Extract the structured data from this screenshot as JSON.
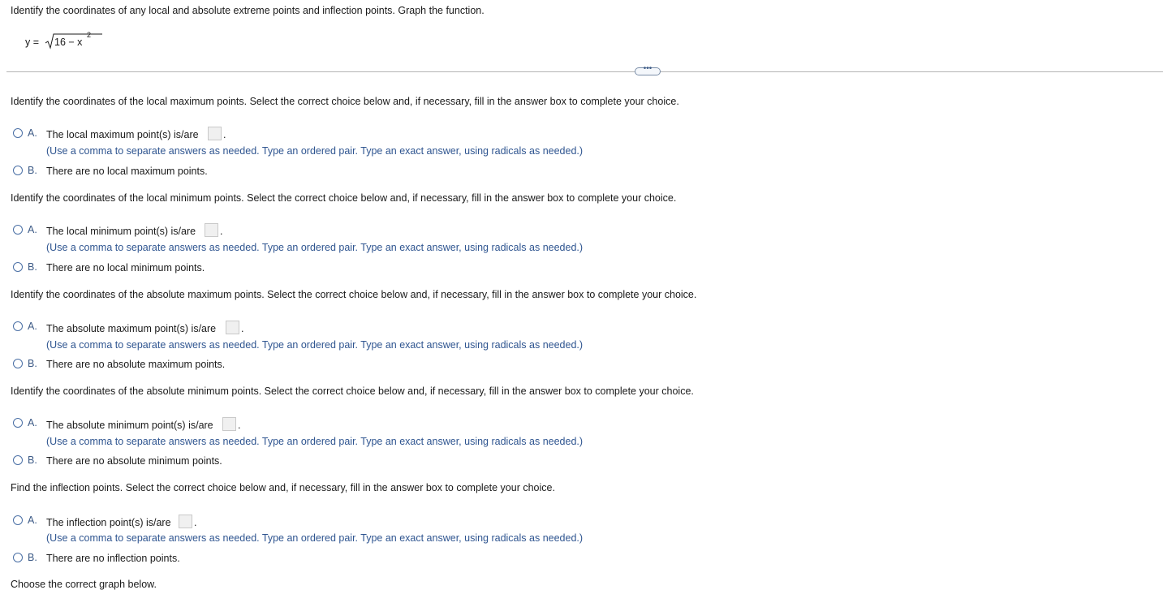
{
  "instruction": "Identify the coordinates of any local and absolute extreme points and inflection points. Graph the function.",
  "equation": {
    "lhs": "y =",
    "radicand": "16 − x",
    "exponent": "2"
  },
  "more_button": "•••",
  "sections": [
    {
      "question": "Identify the coordinates of the local maximum points. Select the correct choice below and, if necessary, fill in the answer box to complete your choice.",
      "option_a_letter": "A.",
      "option_a_text": "The local maximum point(s) is/are",
      "option_a_value": "",
      "period": ".",
      "hint": "(Use a comma to separate answers as needed. Type an ordered pair. Type an exact answer, using radicals as needed.)",
      "option_b_letter": "B.",
      "option_b_text": "There are no local maximum points."
    },
    {
      "question": "Identify the coordinates of the local minimum points. Select the correct choice below and, if necessary, fill in the answer box to complete your choice.",
      "option_a_letter": "A.",
      "option_a_text": "The local minimum point(s) is/are",
      "option_a_value": "",
      "period": ".",
      "hint": "(Use a comma to separate answers as needed. Type an ordered pair. Type an exact answer, using radicals as needed.)",
      "option_b_letter": "B.",
      "option_b_text": "There are no local minimum points."
    },
    {
      "question": "Identify the coordinates of the absolute maximum points. Select the correct choice below and, if necessary, fill in the answer box to complete your choice.",
      "option_a_letter": "A.",
      "option_a_text": "The absolute maximum point(s) is/are",
      "option_a_value": "",
      "period": ".",
      "hint": "(Use a comma to separate answers as needed. Type an ordered pair. Type an exact answer, using radicals as needed.)",
      "option_b_letter": "B.",
      "option_b_text": "There are no absolute maximum points."
    },
    {
      "question": "Identify the coordinates of the absolute minimum points. Select the correct choice below and, if necessary, fill in the answer box to complete your choice.",
      "option_a_letter": "A.",
      "option_a_text": "The absolute minimum point(s) is/are",
      "option_a_value": "",
      "period": ".",
      "hint": "(Use a comma to separate answers as needed. Type an ordered pair. Type an exact answer, using radicals as needed.)",
      "option_b_letter": "B.",
      "option_b_text": "There are no absolute minimum points."
    },
    {
      "question": "Find the inflection points. Select the correct choice below and, if necessary, fill in the answer box to complete your choice.",
      "option_a_letter": "A.",
      "option_a_text": "The inflection point(s) is/are",
      "option_a_value": "",
      "period": ".",
      "hint": "(Use a comma to separate answers as needed. Type an ordered pair. Type an exact answer, using radicals as needed.)",
      "option_b_letter": "B.",
      "option_b_text": "There are no inflection points."
    }
  ],
  "graph_prompt": "Choose the correct graph below."
}
